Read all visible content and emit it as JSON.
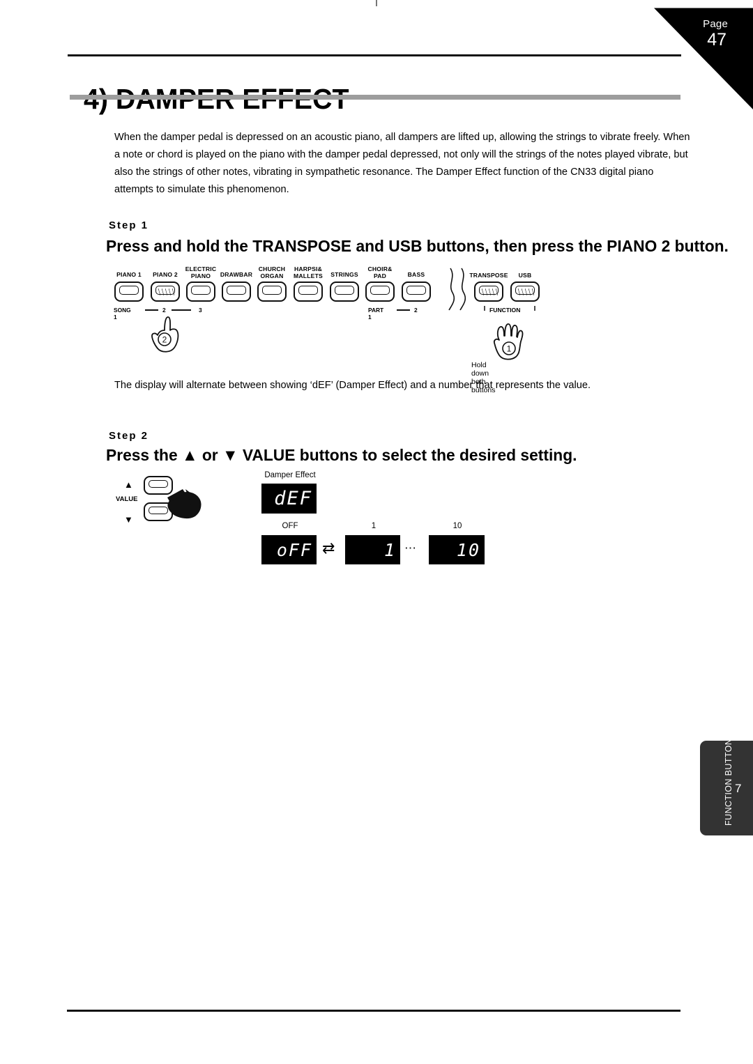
{
  "page": {
    "tab_word": "Page",
    "number": "47",
    "title": "4) DAMPER EFFECT",
    "intro": "When the damper pedal is depressed on an acoustic piano, all dampers are lifted up, allowing the strings to vibrate freely. When a note or chord is played on the piano with the damper pedal depressed, not only will the strings of the notes played vibrate, but also the strings of other notes, vibrating in sympathetic resonance. The Damper Effect function of the CN33 digital piano attempts to simulate this phenomenon."
  },
  "step1": {
    "label": "Step  1",
    "heading": "Press and hold the TRANSPOSE and USB buttons, then press the PIANO 2 button.",
    "note": "The display will alternate between showing ‘dEF’ (Damper Effect) and a number that represents the value.",
    "hold_text": "Hold down both buttons",
    "hand_numbers": {
      "transpose_usb": "1",
      "piano2": "2"
    }
  },
  "step2": {
    "label": "Step  2",
    "heading": "Press the  ▲ or  ▼ VALUE buttons to select the desired setting.",
    "value_label": "VALUE",
    "up_arrow": "▲",
    "down_arrow": "▼"
  },
  "panel": {
    "sound_buttons": [
      {
        "label": "PIANO 1",
        "lit": false
      },
      {
        "label": "PIANO 2",
        "lit": true
      },
      {
        "label": "ELECTRIC\nPIANO",
        "lit": false
      },
      {
        "label": "DRAWBAR",
        "lit": false
      },
      {
        "label": "CHURCH\nORGAN",
        "lit": false
      },
      {
        "label": "HARPSI&\nMALLETS",
        "lit": false
      },
      {
        "label": "STRINGS",
        "lit": false
      },
      {
        "label": "CHOIR&\nPAD",
        "lit": false
      },
      {
        "label": "BASS",
        "lit": false
      }
    ],
    "song_group": {
      "prefix": "SONG 1",
      "items": [
        "2",
        "3"
      ]
    },
    "part_group": {
      "prefix": "PART 1",
      "items": [
        "2"
      ]
    },
    "function_buttons": [
      {
        "label": "TRANSPOSE",
        "lit": true
      },
      {
        "label": "USB",
        "lit": true
      }
    ],
    "function_group_label": "FUNCTION"
  },
  "displays": {
    "top": {
      "caption": "Damper Effect",
      "value": "dEF"
    },
    "sequence": [
      {
        "caption": "OFF",
        "value": "oFF"
      },
      {
        "caption": "1",
        "value": "1"
      },
      {
        "caption": "10",
        "value": "10"
      }
    ],
    "exchange_symbol": "⇄",
    "ellipsis": "⋯"
  },
  "side_tab": {
    "text": "FUNCTION BUTTONS",
    "number": "7"
  }
}
